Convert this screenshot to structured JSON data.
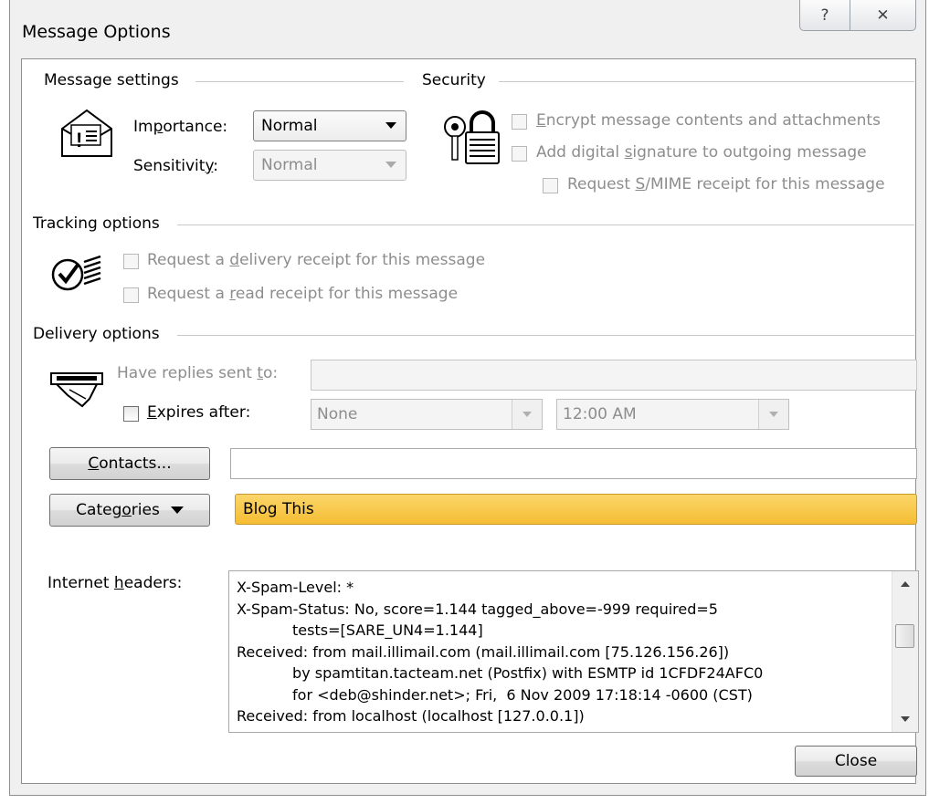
{
  "window": {
    "title": "Message Options",
    "help_glyph": "?",
    "close_glyph": "✕"
  },
  "message_settings": {
    "heading": "Message settings",
    "importance_label_a": "Im",
    "importance_label_u": "p",
    "importance_label_b": "ortance:",
    "importance_value": "Normal",
    "sensitivity_label_a": "Sensitivit",
    "sensitivity_label_u": "y",
    "sensitivity_label_b": ":",
    "sensitivity_value": "Normal"
  },
  "security": {
    "heading": "Security",
    "encrypt_u": "E",
    "encrypt_b": "ncrypt message contents and attachments",
    "signature_a": "Add digital ",
    "signature_u": "s",
    "signature_b": "ignature to outgoing message",
    "smime_a": "Request ",
    "smime_u": "S",
    "smime_b": "/MIME receipt for this message"
  },
  "tracking": {
    "heading": "Tracking options",
    "delivery_a": "Request a ",
    "delivery_u": "d",
    "delivery_b": "elivery receipt for this message",
    "read_a": "Request a ",
    "read_u": "r",
    "read_b": "ead receipt for this message"
  },
  "delivery": {
    "heading": "Delivery options",
    "replies_a": "Have replies sent ",
    "replies_u": "t",
    "replies_b": "o:",
    "expires_u": "E",
    "expires_b": "xpires after:",
    "expires_date": "None",
    "expires_time": "12:00 AM"
  },
  "contacts": {
    "button_u": "C",
    "button_b": "ontacts..."
  },
  "categories": {
    "button_a": "Categ",
    "button_u": "o",
    "button_b": "ries",
    "value": "Blog This",
    "color": "#f8c63f"
  },
  "internet_headers": {
    "label_a": "Internet ",
    "label_u": "h",
    "label_b": "eaders:",
    "lines": [
      "X-Spam-Level: *",
      "X-Spam-Status: No, score=1.144 tagged_above=-999 required=5",
      "            tests=[SARE_UN4=1.144]",
      "Received: from mail.illimail.com (mail.illimail.com [75.126.156.26])",
      "            by spamtitan.tacteam.net (Postfix) with ESMTP id 1CFDF24AFC0",
      "            for <deb@shinder.net>; Fri,  6 Nov 2009 17:18:14 -0600 (CST)",
      "Received: from localhost (localhost [127.0.0.1])"
    ]
  },
  "footer": {
    "close_label": "Close"
  }
}
